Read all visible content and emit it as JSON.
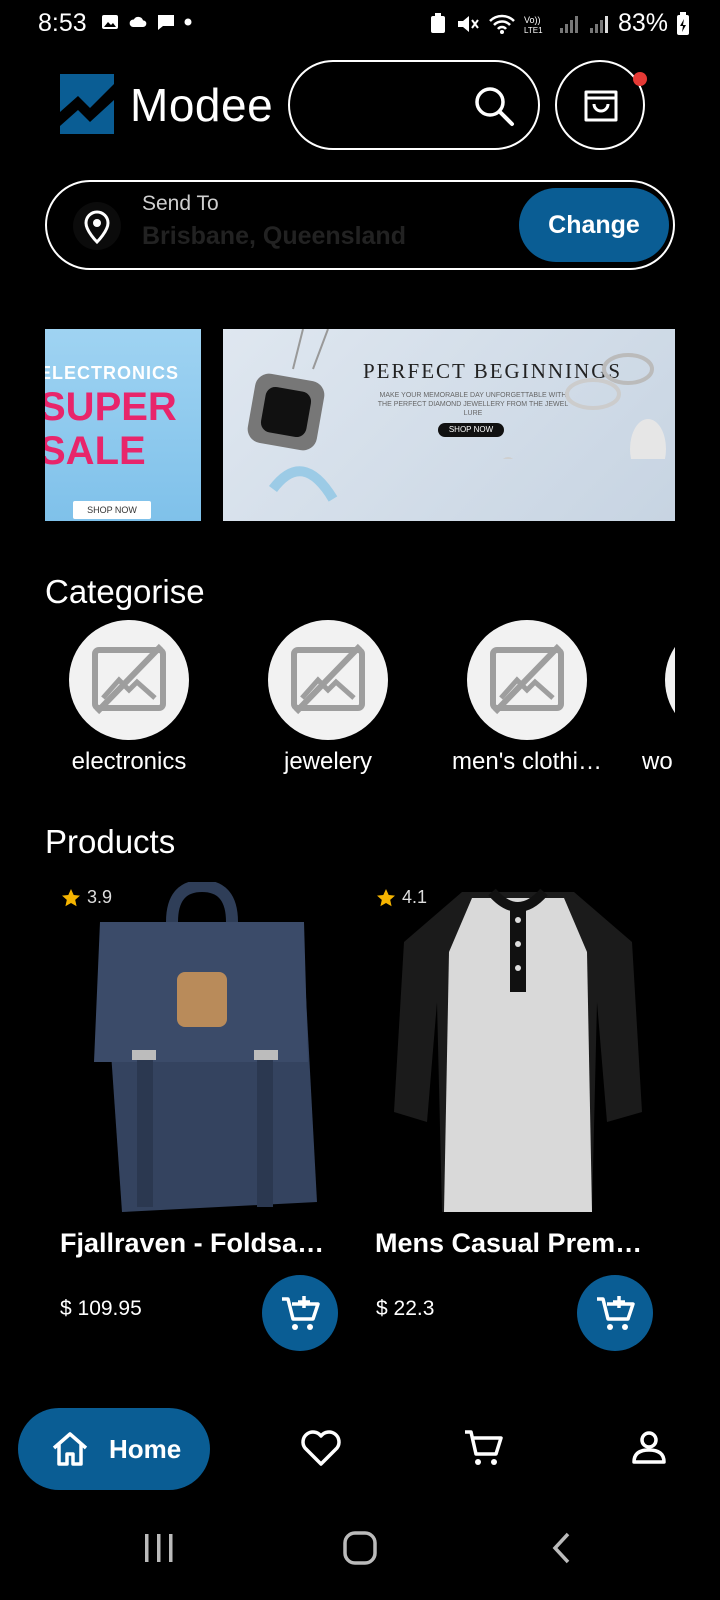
{
  "status_bar": {
    "time": "8:53",
    "battery": "83%"
  },
  "app": {
    "brand": "Modee",
    "accent_color": "#0a5d94"
  },
  "header": {
    "search_icon": "search-icon",
    "cart_icon": "shopping-bag-icon",
    "cart_has_badge": true
  },
  "location": {
    "label": "Send To",
    "value": "Brisbane, Queensland",
    "change_label": "Change"
  },
  "banners": [
    {
      "line1": "ELECTRONICS",
      "line2": "SUPER",
      "line3": "SALE",
      "cta": "SHOP NOW"
    },
    {
      "title": "PERFECT BEGINNINGS",
      "subtitle": "MAKE YOUR MEMORABLE DAY UNFORGETTABLE WITH THE PERFECT DIAMOND JEWELLERY FROM THE JEWEL LURE",
      "cta": "SHOP NOW"
    }
  ],
  "categories": {
    "title": "Categorise",
    "items": [
      {
        "label": "electronics"
      },
      {
        "label": "jewelery"
      },
      {
        "label": "men's clothi…"
      },
      {
        "label": "wo"
      }
    ]
  },
  "products": {
    "title": "Products",
    "items": [
      {
        "rating": "3.9",
        "title": "Fjallraven - Foldsa…",
        "price": "$ 109.95"
      },
      {
        "rating": "4.1",
        "title": "Mens Casual Prem…",
        "price": "$ 22.3"
      }
    ]
  },
  "bottom_nav": {
    "home_label": "Home",
    "items": [
      "heart-icon",
      "cart-icon",
      "profile-icon"
    ]
  }
}
